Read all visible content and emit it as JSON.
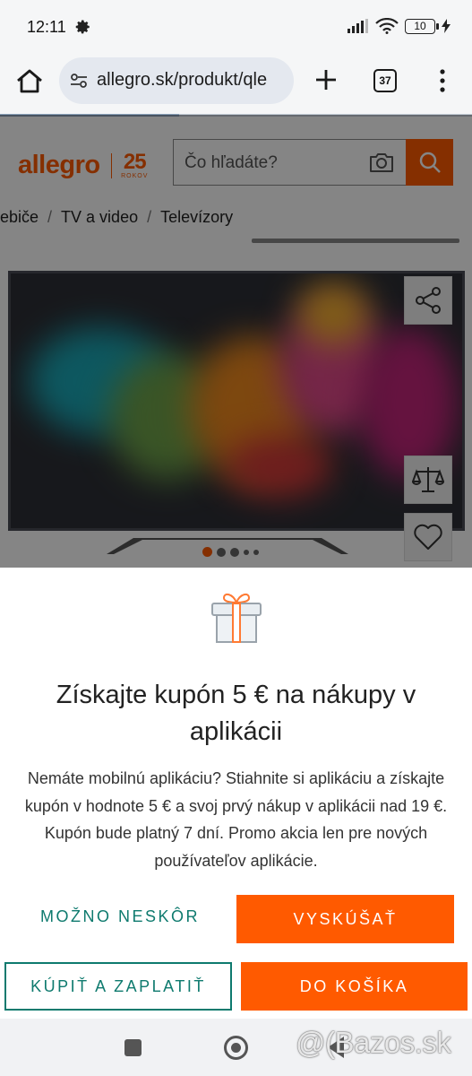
{
  "status_bar": {
    "time": "12:11",
    "battery": "10"
  },
  "browser": {
    "url": "allegro.sk/produkt/qle",
    "tab_count": "37"
  },
  "page": {
    "logo_word": "allegro",
    "logo_years": "25",
    "logo_years_label": "ROKOV",
    "search_placeholder": "Čo hľadáte?",
    "breadcrumb": [
      "ebiče",
      "TV a video",
      "Televízory"
    ]
  },
  "sheet": {
    "title": "Získajte kupón 5 € na nákupy v aplikácii",
    "body": "Nemáte mobilnú aplikáciu? Stiahnite si aplikáciu a získajte kupón v hodnote 5 € a svoj prvý nákup v aplikácii nad 19 €. Kupón bude platný 7 dní. Promo akcia len pre nových používateľov aplikácie.",
    "later_label": "MOŽNO NESKÔR",
    "try_label": "VYSKÚŠAŤ"
  },
  "actions": {
    "buy_label": "KÚPIŤ A ZAPLATIŤ",
    "cart_label": "DO KOŠÍKA"
  },
  "watermark": "@(Bazos.sk",
  "colors": {
    "brand": "#ff5a00",
    "teal": "#0e7a6e"
  }
}
